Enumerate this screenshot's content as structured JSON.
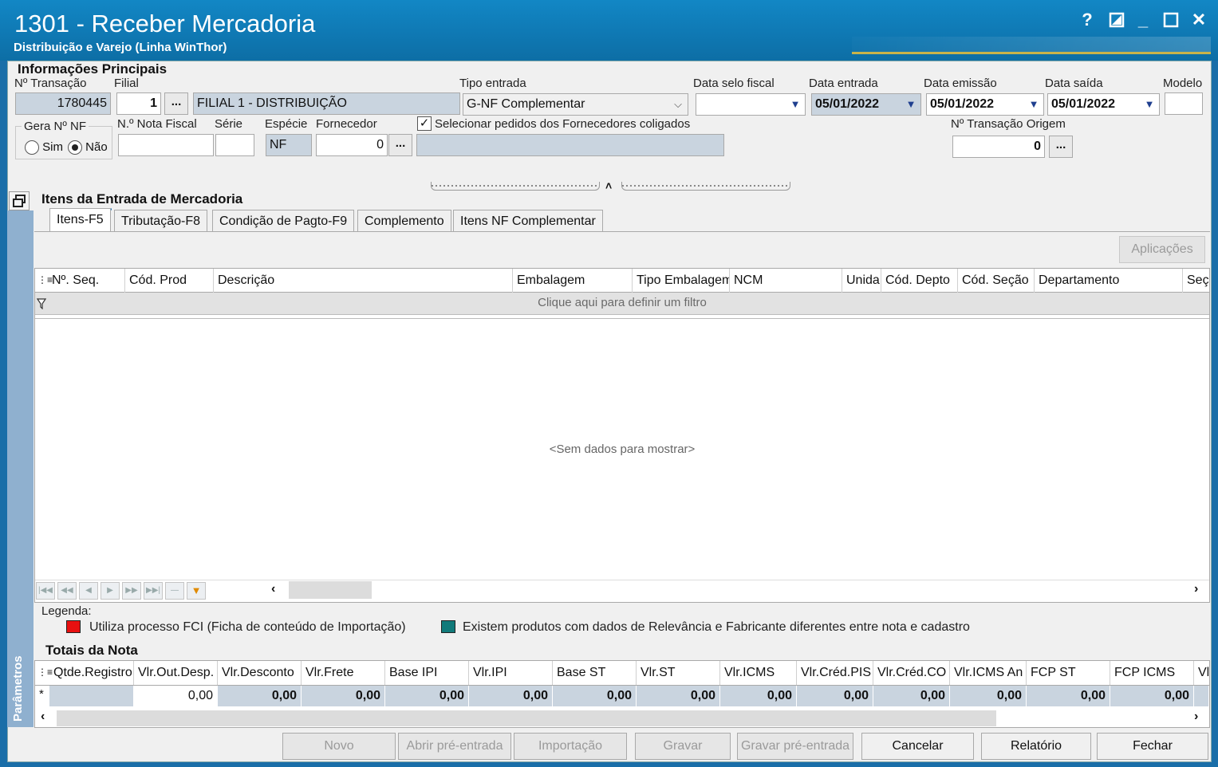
{
  "window": {
    "title": "1301 - Receber Mercadoria",
    "subtitle": "Distribuição e Varejo (Linha WinThor)",
    "help": "?",
    "restore_icon": "resize-icon",
    "minimize": "_",
    "maximize": "☐",
    "close": "✕"
  },
  "info": {
    "section_title": "Informações Principais",
    "transacao_label": "Nº Transação",
    "transacao_value": "1780445",
    "filial_label": "Filial",
    "filial_value": "1",
    "filial_button": "...",
    "filial_nome": "FILIAL 1 - DISTRIBUIÇÃO",
    "tipo_entrada_label": "Tipo entrada",
    "tipo_entrada_value": "G-NF Complementar",
    "data_selo_label": "Data selo fiscal",
    "data_selo_value": "",
    "data_entrada_label": "Data entrada",
    "data_entrada_value": "05/01/2022",
    "data_emissao_label": "Data emissão",
    "data_emissao_value": "05/01/2022",
    "data_saida_label": "Data saída",
    "data_saida_value": "05/01/2022",
    "modelo_label": "Modelo",
    "modelo_value": "",
    "gera_nf_label": "Gera Nº NF",
    "sim_label": "Sim",
    "nao_label": "Não",
    "nota_fiscal_label": "N.º Nota Fiscal",
    "nota_fiscal_value": "",
    "serie_label": "Série",
    "serie_value": "",
    "especie_label": "Espécie",
    "especie_value": "NF",
    "fornecedor_label": "Fornecedor",
    "fornecedor_value": "0",
    "fornecedor_button": "...",
    "fornecedor_nome": "",
    "coligados_label": "Selecionar pedidos dos Fornecedores coligados",
    "coligados_checked": true,
    "transacao_origem_label": "Nº Transação Origem",
    "transacao_origem_value": "0",
    "transacao_origem_button": "..."
  },
  "itens": {
    "section_title": "Itens da Entrada de Mercadoria",
    "tabs": [
      "Itens-F5",
      "Tributação-F8",
      "Condição de Pagto-F9",
      "Complemento",
      "Itens NF Complementar"
    ],
    "aplicacoes_button": "Aplicações",
    "columns": [
      "Nº. Seq.",
      "Cód. Prod",
      "Descrição",
      "Embalagem",
      "Tipo Embalagem",
      "NCM",
      "Unida",
      "Cód. Depto",
      "Cód. Seção",
      "Departamento",
      "Seç"
    ],
    "filter_text": "Clique aqui para definir um filtro",
    "empty_text": "<Sem dados para mostrar>"
  },
  "legenda": {
    "title": "Legenda:",
    "items": [
      {
        "color": "#e81010",
        "text": "Utiliza processo FCI (Ficha de conteúdo de Importação)"
      },
      {
        "color": "#117a7a",
        "text": "Existem produtos com dados de Relevância e Fabricante diferentes entre nota e cadastro"
      }
    ]
  },
  "totais": {
    "section_title": "Totais da Nota",
    "columns": [
      "Qtde.Registro",
      "Vlr.Out.Desp.",
      "Vlr.Desconto",
      "Vlr.Frete",
      "Base IPI",
      "Vlr.IPI",
      "Base ST",
      "Vlr.ST",
      "Vlr.ICMS",
      "Vlr.Créd.PIS",
      "Vlr.Créd.CO",
      "Vlr.ICMS An",
      "FCP ST",
      "FCP ICMS",
      "Vl"
    ],
    "values": [
      "",
      "0,00",
      "0,00",
      "0,00",
      "0,00",
      "0,00",
      "0,00",
      "0,00",
      "0,00",
      "0,00",
      "0,00",
      "0,00",
      "0,00",
      "0,00",
      ""
    ],
    "row_marker": "*"
  },
  "side_panel": {
    "label": "Parâmetros"
  },
  "buttons": {
    "novo": "Novo",
    "abrir": "Abrir pré-entrada",
    "importacao": "Importação",
    "gravar": "Gravar",
    "gravar_pre": "Gravar pré-entrada",
    "cancelar": "Cancelar",
    "relatorio": "Relatório",
    "fechar": "Fechar"
  },
  "colors": {
    "titlebar": "#0f79b4",
    "side_panel": "#8fb0cf"
  }
}
